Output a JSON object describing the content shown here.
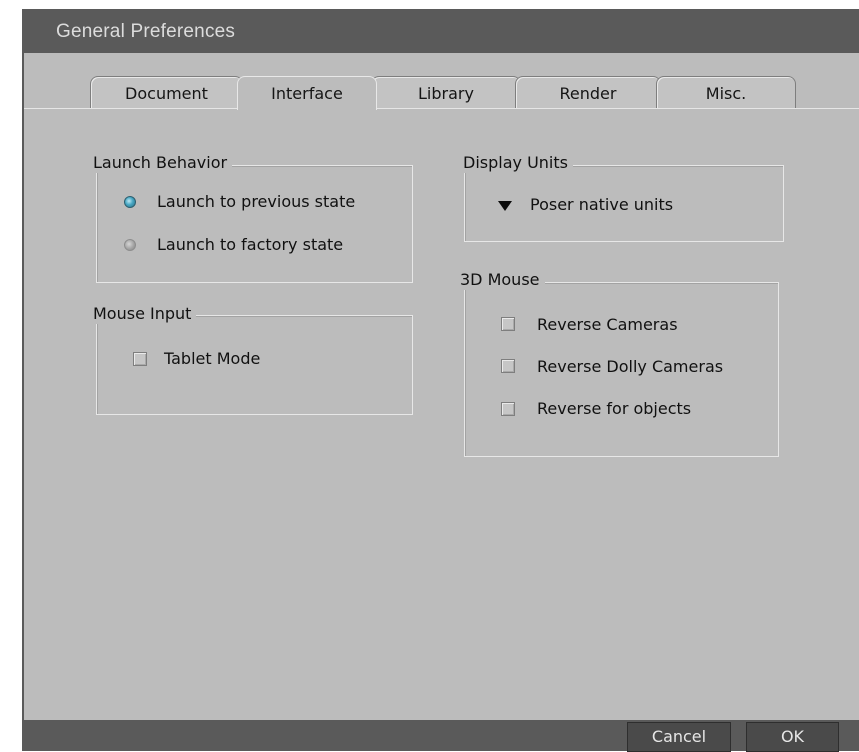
{
  "window": {
    "title": "General Preferences"
  },
  "tabs": [
    {
      "label": "Document"
    },
    {
      "label": "Interface",
      "active": true
    },
    {
      "label": "Library"
    },
    {
      "label": "Render"
    },
    {
      "label": "Misc."
    }
  ],
  "launch_behavior": {
    "title": "Launch Behavior",
    "options": [
      {
        "label": "Launch to previous state",
        "selected": true
      },
      {
        "label": "Launch to factory state",
        "selected": false
      }
    ]
  },
  "mouse_input": {
    "title": "Mouse Input",
    "tablet_mode": {
      "label": "Tablet Mode",
      "checked": false
    }
  },
  "display_units": {
    "title": "Display Units",
    "selected": "Poser native units"
  },
  "mouse_3d": {
    "title": "3D Mouse",
    "options": [
      {
        "label": "Reverse Cameras",
        "checked": false
      },
      {
        "label": "Reverse Dolly Cameras",
        "checked": false
      },
      {
        "label": "Reverse for objects",
        "checked": false
      }
    ]
  },
  "footer": {
    "cancel_label": "Cancel",
    "ok_label": "OK"
  },
  "colors": {
    "panel_bg": "#bcbcbc",
    "frame_bg": "#5a5a5a",
    "radio_selected": "#46a6c2"
  },
  "icons": {
    "dropdown": "triangle-down-icon"
  }
}
